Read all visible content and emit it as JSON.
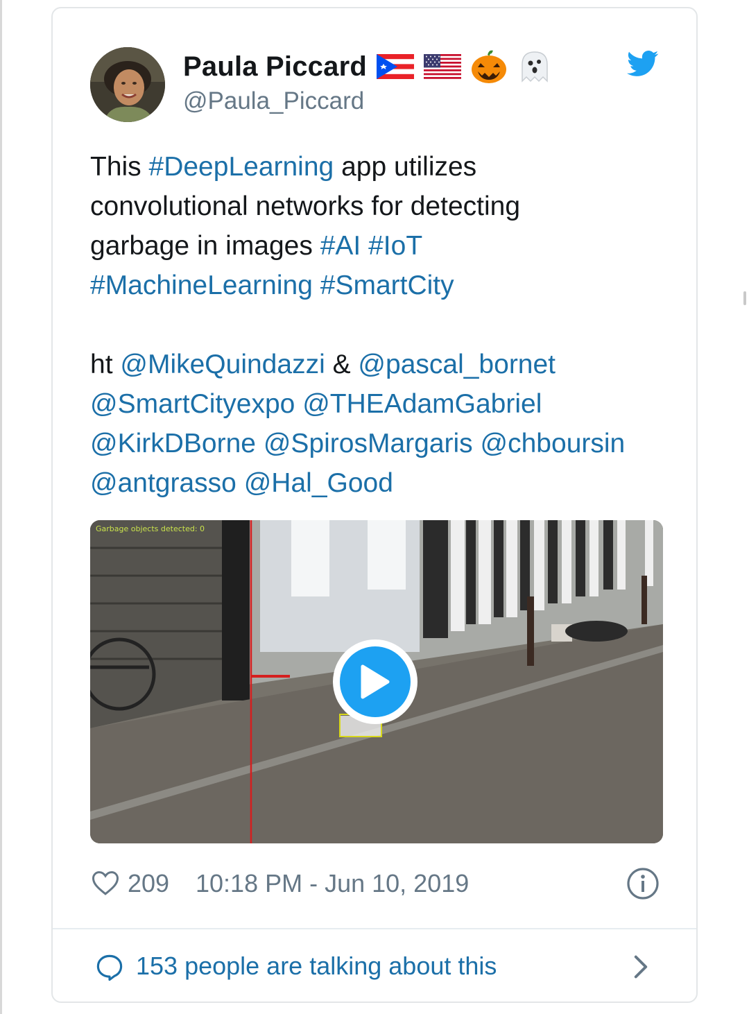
{
  "author": {
    "display_name": "Paula Piccard",
    "handle": "@Paula_Piccard",
    "emoji": [
      "puerto-rico-flag-icon",
      "us-flag-icon",
      "jack-o-lantern-icon",
      "ghost-icon"
    ]
  },
  "tweet": {
    "lines": [
      [
        {
          "t": "This ",
          "k": "text"
        },
        {
          "t": "#DeepLearning",
          "k": "link"
        },
        {
          "t": " app utilizes",
          "k": "text"
        }
      ],
      [
        {
          "t": "convolutional networks for detecting",
          "k": "text"
        }
      ],
      [
        {
          "t": "garbage in images ",
          "k": "text"
        },
        {
          "t": "#AI",
          "k": "link"
        },
        {
          "t": " ",
          "k": "text"
        },
        {
          "t": "#IoT",
          "k": "link"
        }
      ],
      [
        {
          "t": "#MachineLearning",
          "k": "link"
        },
        {
          "t": " ",
          "k": "text"
        },
        {
          "t": "#SmartCity",
          "k": "link"
        }
      ],
      [],
      [
        {
          "t": "ht ",
          "k": "text"
        },
        {
          "t": "@MikeQuindazzi",
          "k": "link"
        },
        {
          "t": " & ",
          "k": "text"
        },
        {
          "t": "@pascal_bornet",
          "k": "link"
        }
      ],
      [
        {
          "t": "@SmartCityexpo",
          "k": "link"
        },
        {
          "t": " ",
          "k": "text"
        },
        {
          "t": "@THEAdamGabriel",
          "k": "link"
        }
      ],
      [
        {
          "t": "@KirkDBorne",
          "k": "link"
        },
        {
          "t": " ",
          "k": "text"
        },
        {
          "t": "@SpirosMargaris",
          "k": "link"
        },
        {
          "t": " ",
          "k": "text"
        },
        {
          "t": "@chboursin",
          "k": "link"
        }
      ],
      [
        {
          "t": "@antgrasso",
          "k": "link"
        },
        {
          "t": " ",
          "k": "text"
        },
        {
          "t": "@Hal_Good",
          "k": "link"
        }
      ]
    ]
  },
  "video": {
    "overlay_text": "Garbage objects detected: 0"
  },
  "meta": {
    "like_count": "209",
    "timestamp": "10:18 PM - Jun 10, 2019"
  },
  "footer": {
    "talking_text": "153 people are talking about this"
  },
  "colors": {
    "link": "#1b6fa8",
    "twitter_blue": "#1da1f2",
    "muted": "#657786"
  }
}
